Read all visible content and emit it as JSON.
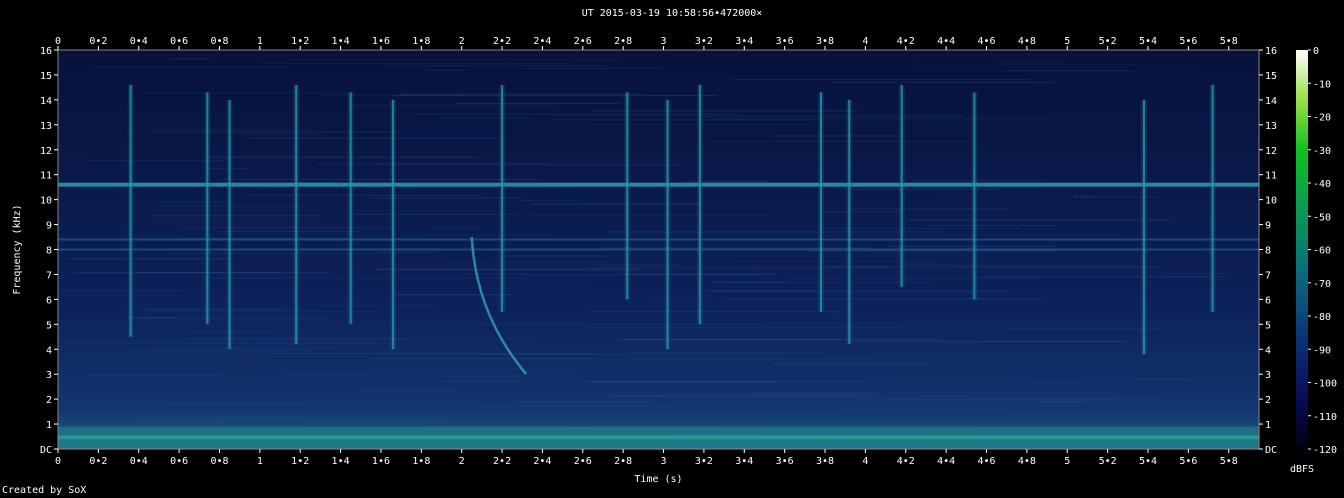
{
  "chart_data": {
    "type": "heatmap",
    "title": "UT 2015-03-19 10:58:56•472000×",
    "xlabel": "Time (s)",
    "ylabel": "Frequency (kHz)",
    "xlim": [
      0,
      5.95
    ],
    "ylim": [
      0,
      16
    ],
    "x_ticks": [
      "0",
      "0•2",
      "0•4",
      "0•6",
      "0•8",
      "1",
      "1•2",
      "1•4",
      "1•6",
      "1•8",
      "2",
      "2•2",
      "2•4",
      "2•6",
      "2•8",
      "3",
      "3•2",
      "3•4",
      "3•6",
      "3•8",
      "4",
      "4•2",
      "4•4",
      "4•6",
      "4•8",
      "5",
      "5•2",
      "5•4",
      "5•6",
      "5•8"
    ],
    "y_ticks": [
      "DC",
      "1",
      "2",
      "3",
      "4",
      "5",
      "6",
      "7",
      "8",
      "9",
      "10",
      "11",
      "12",
      "13",
      "14",
      "15",
      "16"
    ],
    "colorbar": {
      "label": "dBFS",
      "ticks": [
        "0",
        "-10",
        "-20",
        "-30",
        "-40",
        "-50",
        "-60",
        "-70",
        "-80",
        "-90",
        "-100",
        "-110",
        "-120"
      ],
      "range": [
        -120,
        0
      ]
    },
    "features": {
      "tone_lines_khz": [
        10.6,
        8.4,
        8.0
      ],
      "low_band_khz": [
        0,
        0.9
      ],
      "impulse_times_s": [
        0.36,
        0.74,
        0.85,
        1.18,
        1.45,
        1.66,
        2.2,
        2.82,
        3.02,
        3.18,
        3.78,
        3.92,
        4.18,
        4.54,
        5.38,
        5.72
      ],
      "whistler": {
        "start_time_s": 2.05,
        "start_khz": 8.5,
        "end_time_s": 2.32,
        "end_khz": 3.0
      }
    }
  },
  "footer": {
    "credit": "Created by SoX"
  }
}
